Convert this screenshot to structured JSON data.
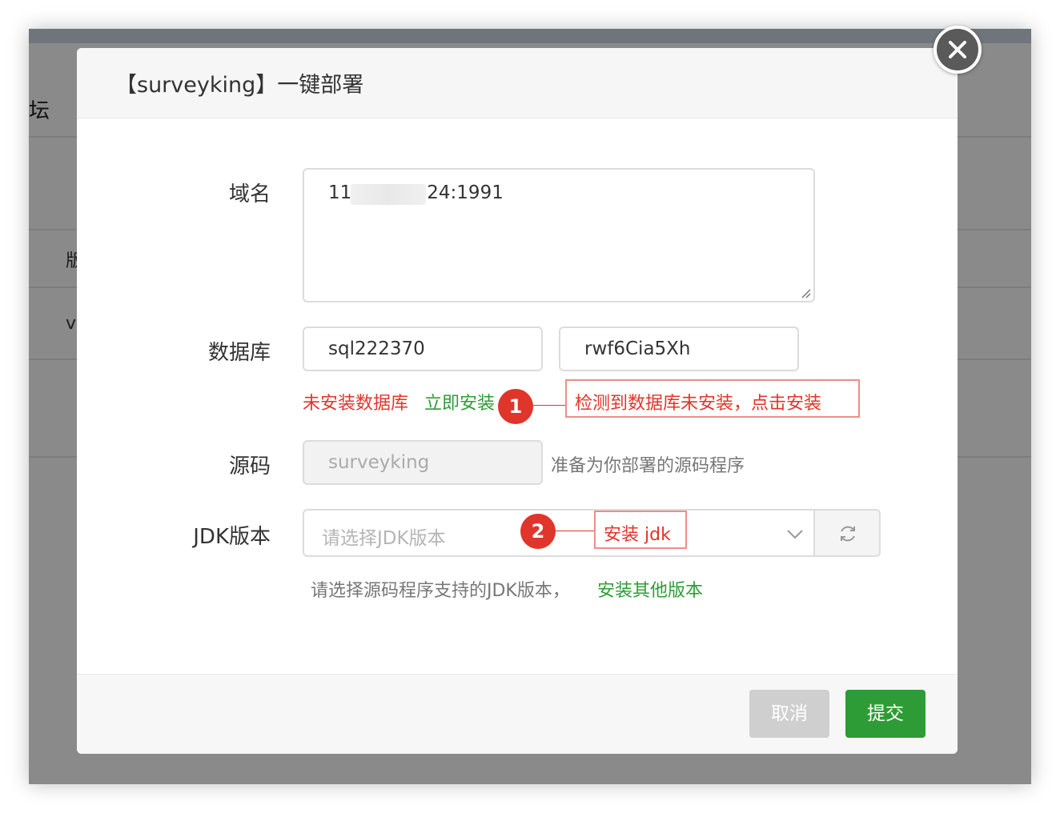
{
  "background": {
    "forum_fragment": "坛",
    "row_fragment_1": "版",
    "row_fragment_2": "v"
  },
  "modal": {
    "title": "【surveyking】一键部署"
  },
  "form": {
    "domain": {
      "label": "域名",
      "value_prefix": "11",
      "value_suffix": "24:1991"
    },
    "database": {
      "label": "数据库",
      "name_value": "sql222370",
      "password_value": "rwf6Cia5Xh",
      "not_installed_text": "未安装数据库",
      "install_link": "立即安装"
    },
    "source": {
      "label": "源码",
      "value": "surveyking",
      "hint": "准备为你部署的源码程序"
    },
    "jdk": {
      "label": "JDK版本",
      "placeholder": "请选择JDK版本",
      "hint": "请选择源码程序支持的JDK版本，",
      "other_link": "安装其他版本"
    }
  },
  "annotations": [
    {
      "number": "1",
      "text": "检测到数据库未安装，点击安装"
    },
    {
      "number": "2",
      "text": "安装 jdk"
    }
  ],
  "footer": {
    "cancel_label": "取消",
    "submit_label": "提交"
  },
  "colors": {
    "accent_green": "#2e9c36",
    "annotation_red": "#e0352b",
    "overlay": "rgba(0,0,0,0.46)"
  }
}
